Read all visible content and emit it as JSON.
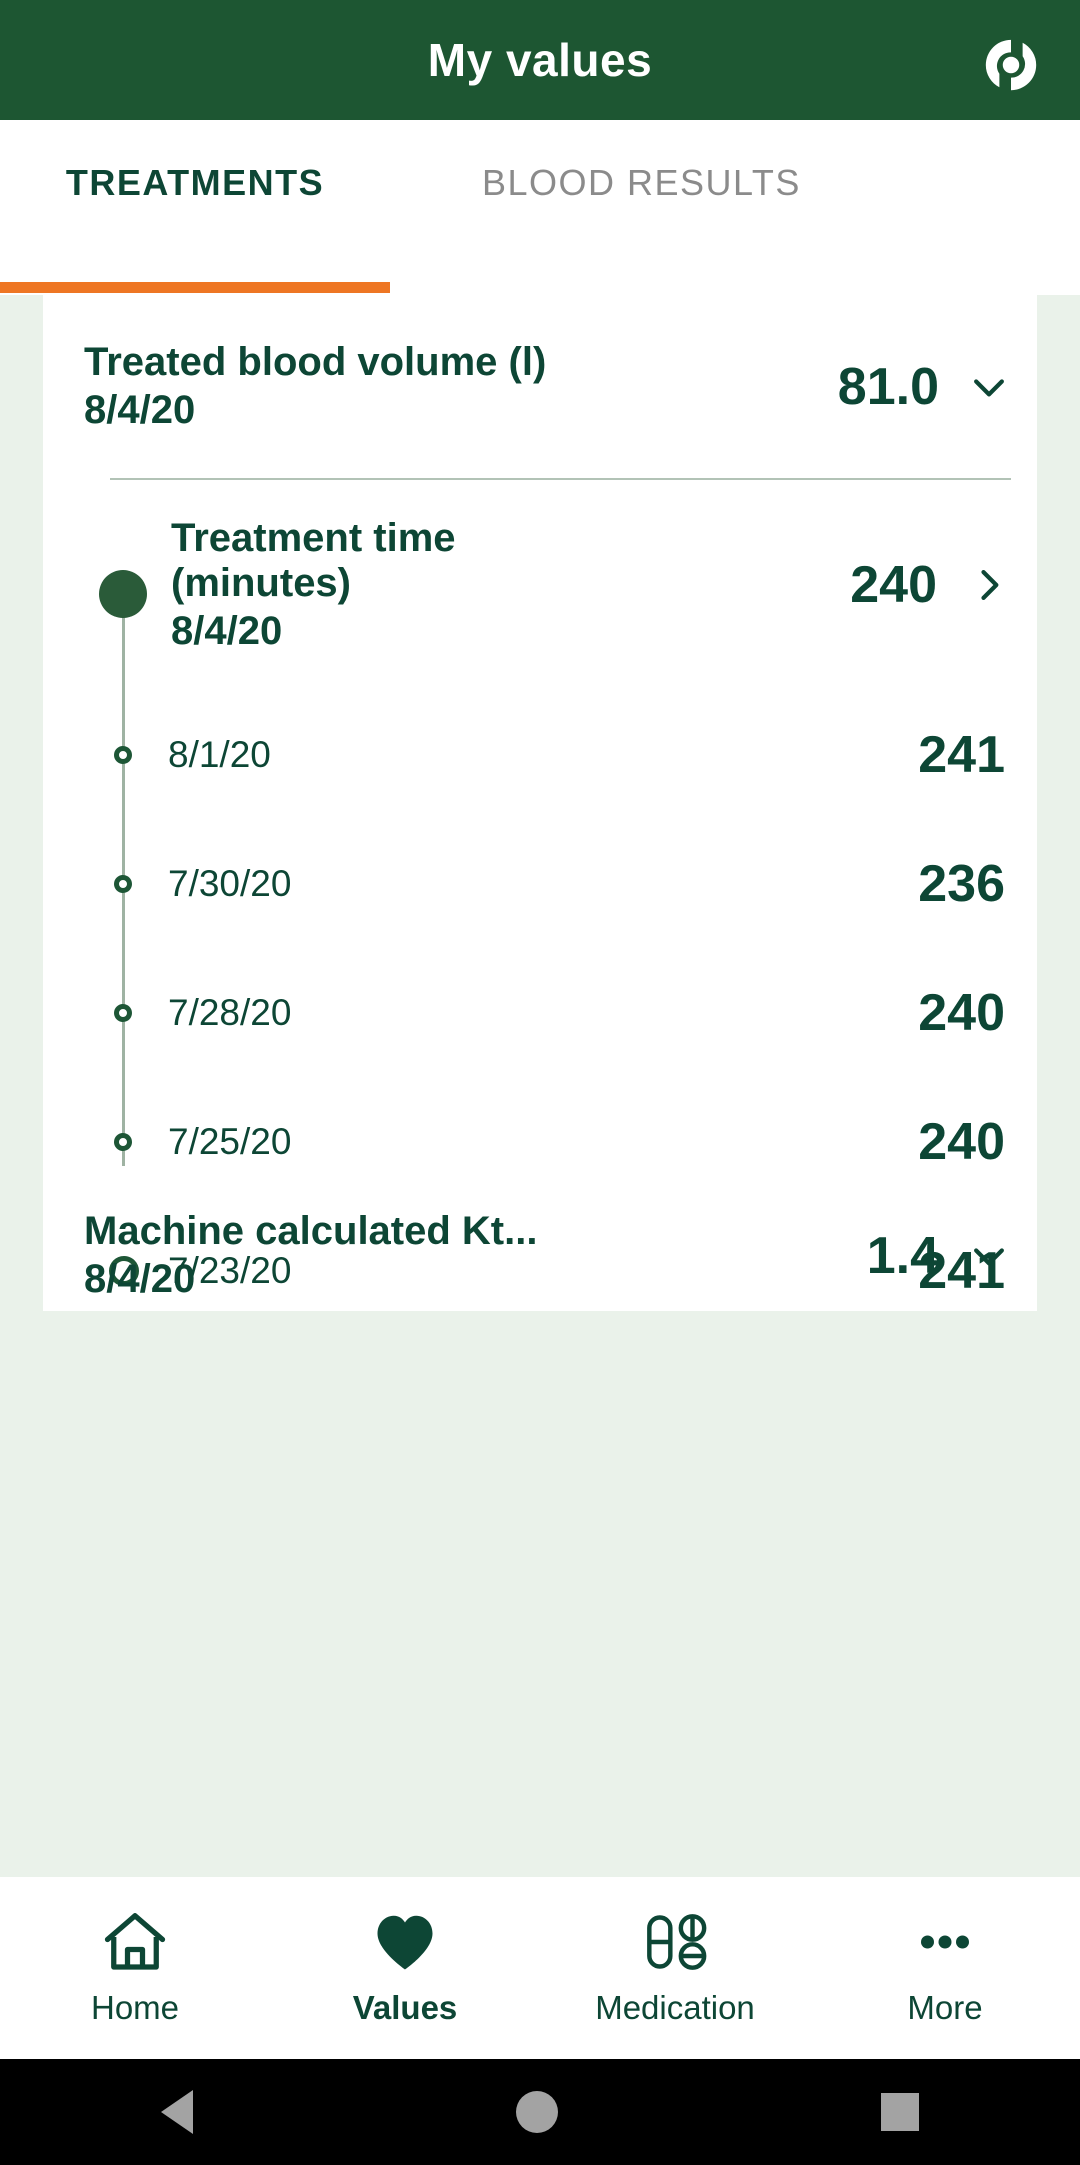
{
  "header": {
    "title": "My values",
    "logo_icon": "brand-swirl-icon",
    "background_color": "#1d5632"
  },
  "tabs": {
    "active_index": 0,
    "accent_color": "#ee7623",
    "items": [
      {
        "label": "TREATMENTS"
      },
      {
        "label": "BLOOD RESULTS"
      }
    ]
  },
  "card": {
    "rows": [
      {
        "title": "Treated blood volume (l)",
        "date": "8/4/20",
        "value": "81.0",
        "state": "collapsed",
        "chevron": "chevron-down-icon"
      },
      {
        "title_line1": "Treatment time",
        "title_line2": "(minutes)",
        "date": "8/4/20",
        "value": "240",
        "state": "expanded",
        "chevron": "chevron-right-icon",
        "history": [
          {
            "date": "8/1/20",
            "value": "241"
          },
          {
            "date": "7/30/20",
            "value": "236"
          },
          {
            "date": "7/28/20",
            "value": "240"
          },
          {
            "date": "7/25/20",
            "value": "240"
          },
          {
            "date": "7/23/20",
            "value": "241"
          }
        ]
      },
      {
        "title": "Machine calculated Kt...",
        "date": "8/4/20",
        "value": "1.4",
        "state": "collapsed",
        "chevron": "chevron-down-icon"
      }
    ]
  },
  "bottom_nav": {
    "active_index": 1,
    "items": [
      {
        "label": "Home",
        "icon": "home-icon"
      },
      {
        "label": "Values",
        "icon": "heart-icon"
      },
      {
        "label": "Medication",
        "icon": "pills-icon"
      },
      {
        "label": "More",
        "icon": "ellipsis-icon"
      }
    ]
  },
  "system_bar": {
    "back": "back-triangle-icon",
    "home": "home-circle-icon",
    "recents": "recents-square-icon"
  },
  "colors": {
    "brand_green": "#1d5632",
    "text_green": "#0d4635",
    "accent_orange": "#ee7623",
    "page_background": "#eaf2ea"
  }
}
